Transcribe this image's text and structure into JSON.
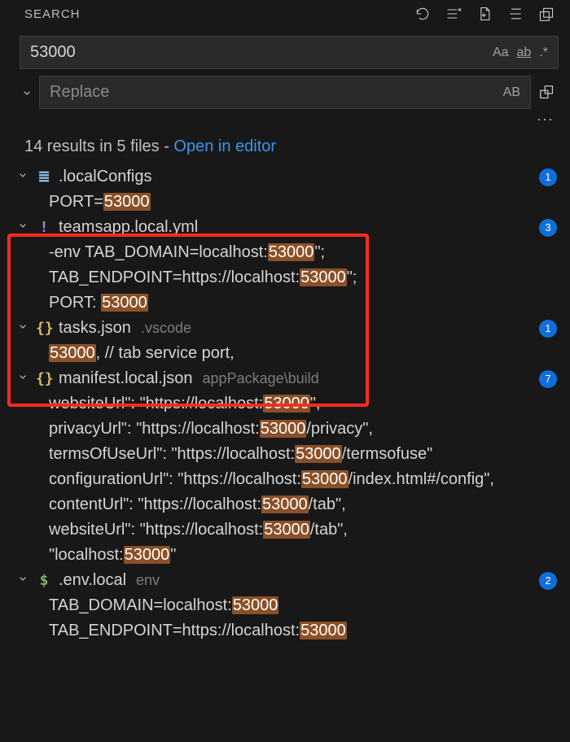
{
  "panel": {
    "title": "SEARCH"
  },
  "inputs": {
    "search_value": "53000",
    "replace_placeholder": "Replace",
    "case_label": "Aa",
    "word_label": "ab",
    "regex_label": ".*",
    "preserve_case_label": "AB"
  },
  "summary": {
    "text": "14 results in 5 files - ",
    "link": "Open in editor"
  },
  "files": [
    {
      "icon": "≣",
      "icon_class": "ic-blue",
      "name": ".localConfigs",
      "path": "",
      "badge": 1,
      "lines": [
        {
          "pre": "PORT=",
          "hit": "53000",
          "post": ""
        }
      ]
    },
    {
      "icon": "!",
      "icon_class": "ic-purple",
      "name": "teamsapp.local.yml",
      "path": "",
      "badge": 3,
      "lines": [
        {
          "pre": "-env TAB_DOMAIN=localhost:",
          "hit": "53000",
          "post": "\";"
        },
        {
          "pre": "TAB_ENDPOINT=https://localhost:",
          "hit": "53000",
          "post": "\";"
        },
        {
          "pre": "PORT: ",
          "hit": "53000",
          "post": ""
        }
      ]
    },
    {
      "icon": "{}",
      "icon_class": "ic-yellow",
      "name": "tasks.json",
      "path": ".vscode",
      "badge": 1,
      "lines": [
        {
          "pre": "",
          "hit": "53000",
          "post": ", // tab service port,"
        }
      ]
    },
    {
      "icon": "{}",
      "icon_class": "ic-yellow",
      "name": "manifest.local.json",
      "path": "appPackage\\build",
      "badge": 7,
      "lines": [
        {
          "pre": "websiteUrl\": \"https://localhost:",
          "hit": "53000",
          "post": "\","
        },
        {
          "pre": "privacyUrl\": \"https://localhost:",
          "hit": "53000",
          "post": "/privacy\","
        },
        {
          "pre": "termsOfUseUrl\": \"https://localhost:",
          "hit": "53000",
          "post": "/termsofuse\""
        },
        {
          "pre": "configurationUrl\": \"https://localhost:",
          "hit": "53000",
          "post": "/index.html#/config\","
        },
        {
          "pre": "contentUrl\": \"https://localhost:",
          "hit": "53000",
          "post": "/tab\","
        },
        {
          "pre": "websiteUrl\": \"https://localhost:",
          "hit": "53000",
          "post": "/tab\","
        },
        {
          "pre": "\"localhost:",
          "hit": "53000",
          "post": "\""
        }
      ]
    },
    {
      "icon": "$",
      "icon_class": "ic-green",
      "name": ".env.local",
      "path": "env",
      "badge": 2,
      "lines": [
        {
          "pre": "TAB_DOMAIN=localhost:",
          "hit": "53000",
          "post": ""
        },
        {
          "pre": "TAB_ENDPOINT=https://localhost:",
          "hit": "53000",
          "post": ""
        }
      ]
    }
  ]
}
